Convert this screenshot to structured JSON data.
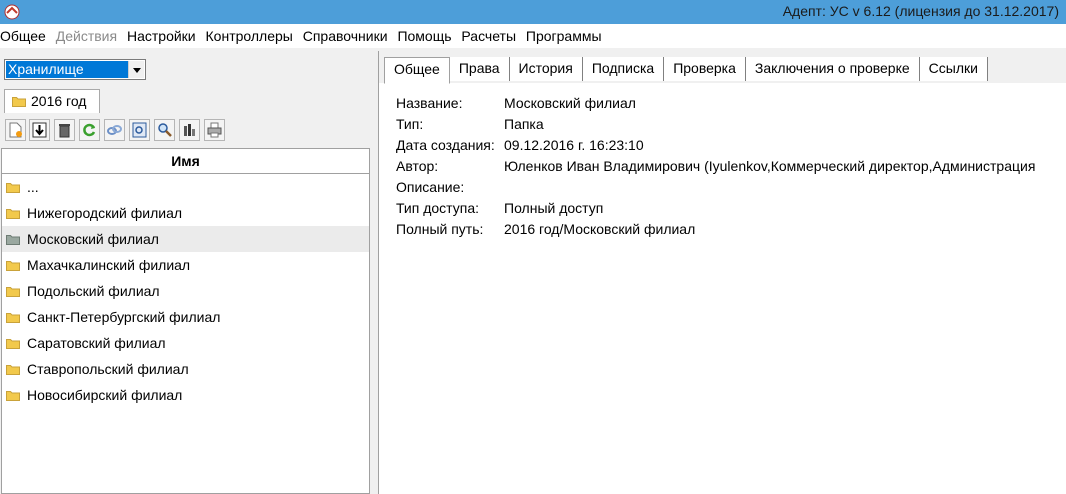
{
  "window": {
    "title": "Адепт: УС  v 6.12 (лицензия до 31.12.2017)",
    "app_icon": "app-logo-icon"
  },
  "menu": [
    {
      "label": "Общее",
      "enabled": true
    },
    {
      "label": "Действия",
      "enabled": false
    },
    {
      "label": "Настройки",
      "enabled": true
    },
    {
      "label": "Контроллеры",
      "enabled": true
    },
    {
      "label": "Справочники",
      "enabled": true
    },
    {
      "label": "Помощь",
      "enabled": true
    },
    {
      "label": "Расчеты",
      "enabled": true
    },
    {
      "label": "Программы",
      "enabled": true
    }
  ],
  "left": {
    "storage_select": {
      "value": "Хранилище"
    },
    "year_tab": {
      "label": "2016 год"
    },
    "toolbar": [
      {
        "name": "new-document-icon"
      },
      {
        "name": "download-icon"
      },
      {
        "name": "trash-icon"
      },
      {
        "name": "refresh-icon"
      },
      {
        "name": "link-icon"
      },
      {
        "name": "preview-icon"
      },
      {
        "name": "search-icon"
      },
      {
        "name": "chart-icon"
      },
      {
        "name": "print-icon"
      }
    ],
    "tree": {
      "header": "Имя",
      "items": [
        {
          "label": "...",
          "selected": false
        },
        {
          "label": "Нижегородский филиал",
          "selected": false
        },
        {
          "label": "Московский филиал",
          "selected": true
        },
        {
          "label": "Махачкалинский филиал",
          "selected": false
        },
        {
          "label": "Подольский филиал",
          "selected": false
        },
        {
          "label": "Санкт-Петербургский филиал",
          "selected": false
        },
        {
          "label": "Саратовский филиал",
          "selected": false
        },
        {
          "label": "Ставропольский филиал",
          "selected": false
        },
        {
          "label": "Новосибирский филиал",
          "selected": false
        }
      ]
    }
  },
  "right": {
    "tabs": [
      "Общее",
      "Права",
      "История",
      "Подписка",
      "Проверка",
      "Заключения о проверке",
      "Ссылки"
    ],
    "active_tab": "Общее",
    "props": [
      {
        "key": "Название:",
        "value": "Московский филиал"
      },
      {
        "key": "Тип:",
        "value": "Папка"
      },
      {
        "key": "Дата создания:",
        "value": "09.12.2016 г. 16:23:10"
      },
      {
        "key": "Автор:",
        "value": "Юленков Иван Владимирович (Iyulenkov,Коммерческий директор,Администрация"
      },
      {
        "key": "Описание:",
        "value": ""
      },
      {
        "key": "Тип доступа:",
        "value": "Полный доступ"
      },
      {
        "key": "Полный путь:",
        "value": "2016 год/Московский филиал"
      }
    ]
  },
  "colors": {
    "titlebar": "#4d9ed9",
    "selection": "#0078d7",
    "folder": "#f2c94c",
    "folder_selected": "#9aa8a0"
  }
}
